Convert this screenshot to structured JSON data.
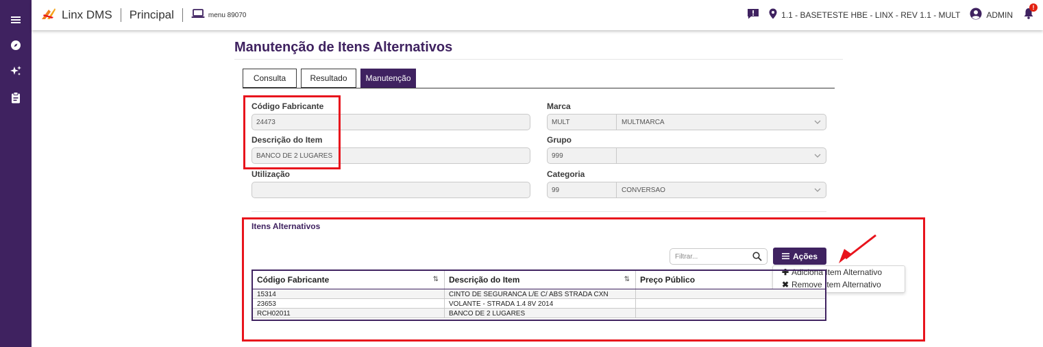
{
  "app": {
    "brand": "Linx DMS",
    "module": "Principal",
    "menu_code": "menu 89070",
    "environment": "1.1 - BASETESTE HBE - LINX - REV 1.1 - MULT",
    "user": "ADMIN",
    "notification_badge": "!"
  },
  "colors": {
    "primary": "#3f2260",
    "highlight": "#e8131c",
    "brand_orange": "#f07f1d"
  },
  "page": {
    "title": "Manutenção de Itens Alternativos",
    "tabs": [
      {
        "label": "Consulta",
        "active": false
      },
      {
        "label": "Resultado",
        "active": false
      },
      {
        "label": "Manutenção",
        "active": true
      }
    ]
  },
  "form": {
    "codigo_fabricante": {
      "label": "Código Fabricante",
      "value": "24473"
    },
    "descricao_item": {
      "label": "Descrição do Item",
      "value": "BANCO DE 2 LUGARES"
    },
    "utilizacao": {
      "label": "Utilização",
      "value": ""
    },
    "marca": {
      "label": "Marca",
      "code": "MULT",
      "description": "MULTMARCA"
    },
    "grupo": {
      "label": "Grupo",
      "code": "999",
      "description": ""
    },
    "categoria": {
      "label": "Categoria",
      "code": "99",
      "description": "CONVERSAO"
    }
  },
  "alternativos": {
    "section_title": "Itens Alternativos",
    "filter_placeholder": "Filtrar...",
    "acoes_label": "Ações",
    "menu": [
      {
        "icon": "plus-icon",
        "glyph": "✚",
        "label": "Adiciona Item Alternativo"
      },
      {
        "icon": "times-icon",
        "glyph": "✖",
        "label": "Remove Item Alternativo"
      }
    ],
    "columns": [
      "Código Fabricante",
      "Descrição do Item",
      "Preço Público"
    ],
    "sort_glyph": "⇅",
    "rows": [
      {
        "codigo": "15314",
        "descricao": "CINTO DE SEGURANCA L/E C/ ABS STRADA CXN",
        "preco": ""
      },
      {
        "codigo": "23653",
        "descricao": "VOLANTE - STRADA 1.4 8V 2014",
        "preco": ""
      },
      {
        "codigo": "RCH02011",
        "descricao": "BANCO DE 2 LUGARES",
        "preco": ""
      }
    ]
  }
}
